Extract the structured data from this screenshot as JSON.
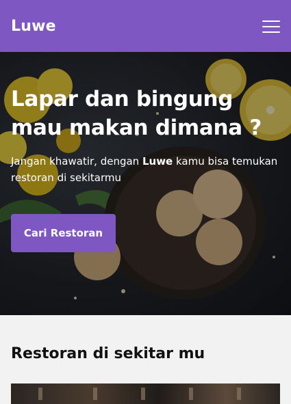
{
  "app": {
    "brand": "Luwe"
  },
  "hero": {
    "title": "Lapar dan bingung mau makan dimana ?",
    "text_before": "Jangan khawatir, dengan ",
    "text_brand": "Luwe",
    "text_after": " kamu bisa temukan restoran di sekitarmu",
    "cta_label": "Cari Restoran"
  },
  "section": {
    "title": "Restoran di sekitar mu"
  },
  "colors": {
    "primary": "#7e57c2",
    "background": "#f2f2f2"
  },
  "icons": {
    "menu": "hamburger-menu-icon"
  }
}
